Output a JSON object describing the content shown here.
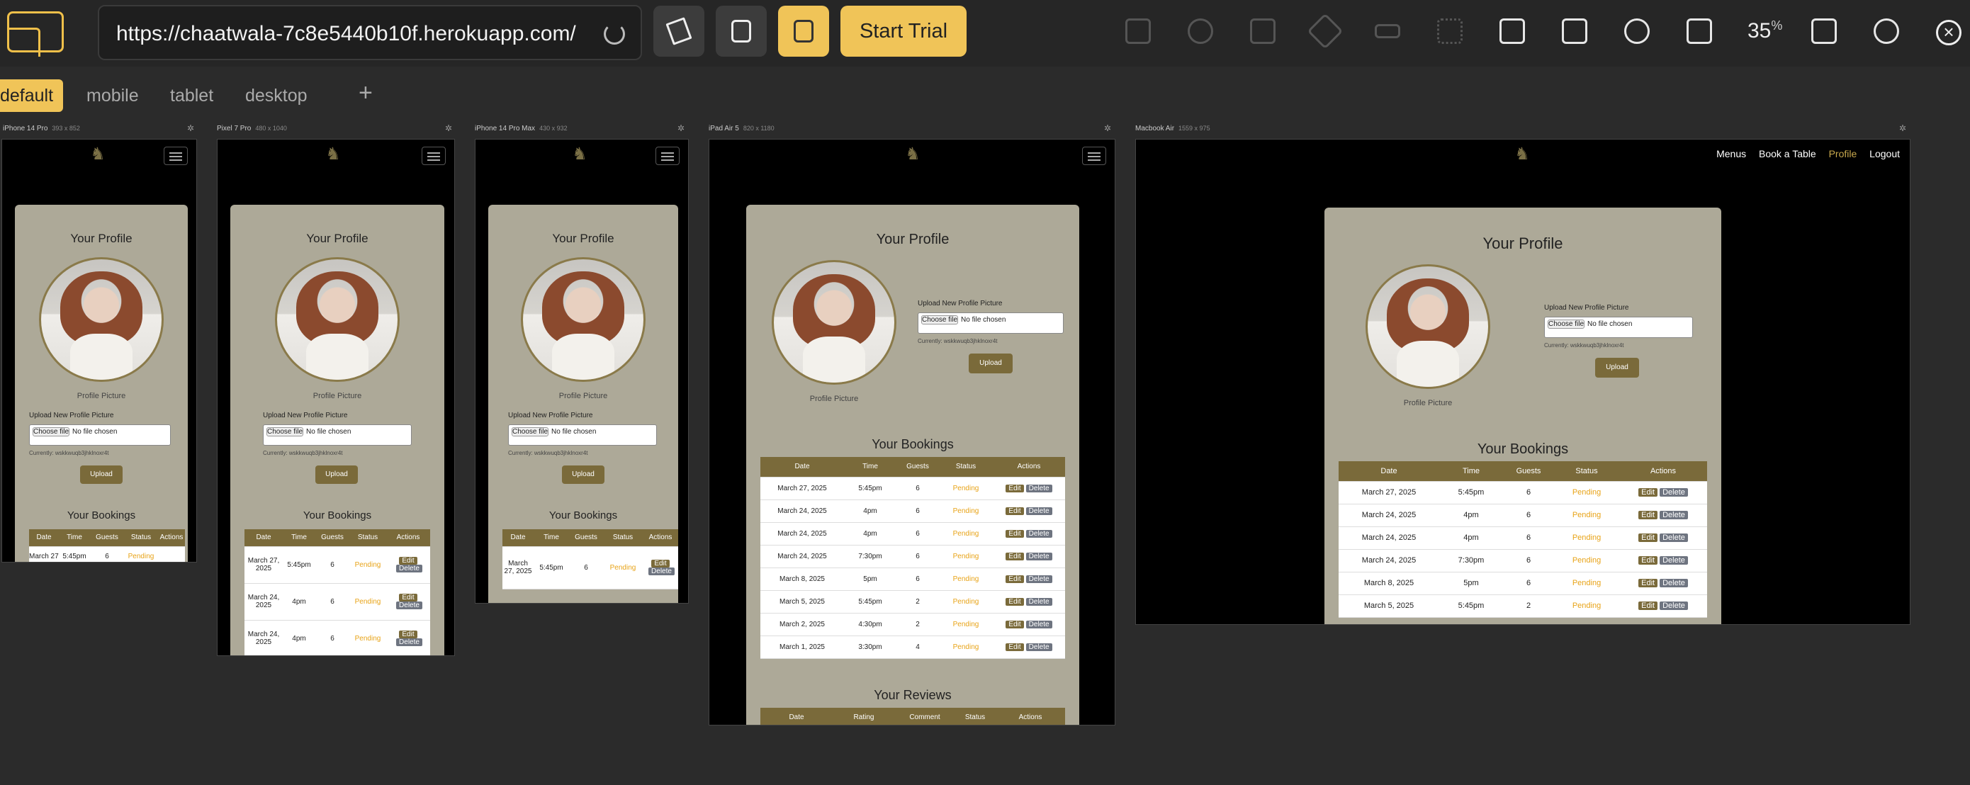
{
  "toolbar": {
    "url": "https://chaatwala-7c8e5440b10f.herokuapp.com/",
    "start_trial_label": "Start Trial",
    "zoom_value": "35",
    "zoom_unit": "%"
  },
  "tabs": [
    {
      "label": "default"
    },
    {
      "label": "mobile"
    },
    {
      "label": "tablet"
    },
    {
      "label": "desktop"
    }
  ],
  "add_tab_label": "+",
  "devices": [
    {
      "name": "iPhone 14 Pro",
      "size": "393 x 852"
    },
    {
      "name": "Pixel 7 Pro",
      "size": "480 x 1040"
    },
    {
      "name": "iPhone 14 Pro Max",
      "size": "430 x 932"
    },
    {
      "name": "iPad Air 5",
      "size": "820 x 1180"
    },
    {
      "name": "Macbook Air",
      "size": "1559 x 975"
    }
  ],
  "site": {
    "nav": {
      "menus": "Menus",
      "book": "Book a Table",
      "profile": "Profile",
      "logout": "Logout"
    },
    "profile_title": "Your Profile",
    "picture_caption": "Profile Picture",
    "upload_label": "Upload New Profile Picture",
    "choose_file": "Choose file",
    "no_file": "No file chosen",
    "currently": "Currently: wskkwuqb3jhklnoxr4t",
    "upload_button": "Upload",
    "bookings_title": "Your Bookings",
    "reviews_title": "Your Reviews",
    "booking_headers": [
      "Date",
      "Time",
      "Guests",
      "Status",
      "Actions"
    ],
    "review_headers": [
      "Date",
      "Rating",
      "Comment",
      "Status",
      "Actions"
    ],
    "edit_label": "Edit",
    "delete_label": "Delete",
    "bookings": [
      {
        "date": "March 27, 2025",
        "time": "5:45pm",
        "guests": "6",
        "status": "Pending"
      },
      {
        "date": "March 24, 2025",
        "time": "4pm",
        "guests": "6",
        "status": "Pending"
      },
      {
        "date": "March 24, 2025",
        "time": "4pm",
        "guests": "6",
        "status": "Pending"
      },
      {
        "date": "March 24, 2025",
        "time": "7:30pm",
        "guests": "6",
        "status": "Pending"
      },
      {
        "date": "March 8, 2025",
        "time": "5pm",
        "guests": "6",
        "status": "Pending"
      },
      {
        "date": "March 5, 2025",
        "time": "5:45pm",
        "guests": "2",
        "status": "Pending"
      },
      {
        "date": "March 2, 2025",
        "time": "4:30pm",
        "guests": "2",
        "status": "Pending"
      },
      {
        "date": "March 1, 2025",
        "time": "3:30pm",
        "guests": "4",
        "status": "Pending"
      }
    ]
  }
}
